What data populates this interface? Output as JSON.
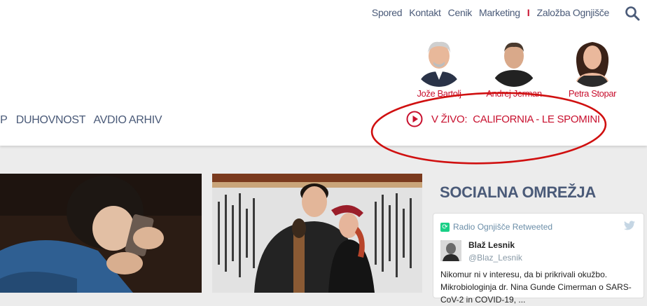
{
  "topnav": {
    "items": [
      "Spored",
      "Kontakt",
      "Cenik",
      "Marketing"
    ],
    "separator": "I",
    "publisher": "Založba Ognjišče"
  },
  "search": {
    "icon": "search-icon"
  },
  "hosts": [
    {
      "name": "Jože Bartolj"
    },
    {
      "name": "Andrej Jerman"
    },
    {
      "name": "Petra Stopar"
    }
  ],
  "mainnav": {
    "items": [
      "IP",
      "DUHOVNOST",
      "AVDIO ARHIV"
    ]
  },
  "live": {
    "prefix": "V ŽIVO:",
    "title": "CALIFORNIA - LE SPOMINI"
  },
  "colors": {
    "accent": "#c8102e",
    "nav": "#4a5a78",
    "retweet": "#19cf86"
  },
  "social": {
    "title": "SOCIALNA OMREŽJA",
    "tweet": {
      "retweeted_by": "Radio Ognjišče Retweeted",
      "name": "Blaž Lesnik",
      "handle": "@Blaz_Lesnik",
      "text": "Nikomur ni v interesu, da bi prikrivali okužbo. Mikrobiologinja dr. Nina Gunde Cimerman o SARS-CoV-2 in COVID-19, ..."
    }
  }
}
